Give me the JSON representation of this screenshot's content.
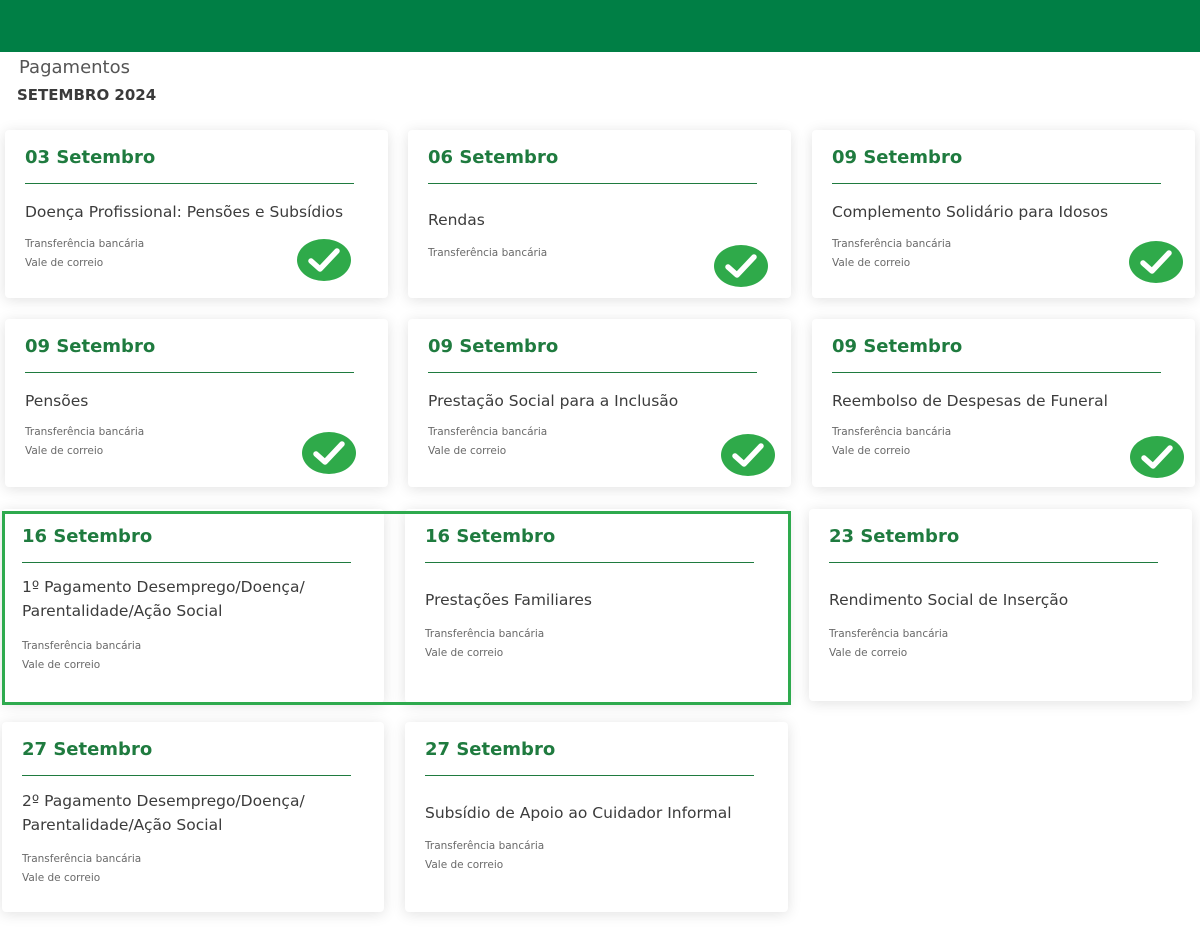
{
  "header": {
    "title": "Pagamentos",
    "subtitle": "SETEMBRO 2024"
  },
  "colors": {
    "brand_green": "#007f45",
    "date_green": "#1f7b3f",
    "check_green": "#2faa4a",
    "highlight_green": "#2eaa4e"
  },
  "cards": [
    {
      "date": "03 Setembro",
      "title": "Doença Profissional: Pensões e Subsídios",
      "methods": [
        "Transferência bancária",
        "Vale de correio"
      ],
      "paid": true,
      "icon": "check-circle-icon"
    },
    {
      "date": "06 Setembro",
      "title": "Rendas",
      "methods": [
        "Transferência bancária"
      ],
      "paid": true,
      "icon": "check-circle-icon"
    },
    {
      "date": "09 Setembro",
      "title": "Complemento Solidário para Idosos",
      "methods": [
        "Transferência bancária",
        "Vale de correio"
      ],
      "paid": true,
      "icon": "check-circle-icon"
    },
    {
      "date": "09 Setembro",
      "title": "Pensões",
      "methods": [
        "Transferência bancária",
        "Vale de correio"
      ],
      "paid": true,
      "icon": "check-circle-icon"
    },
    {
      "date": "09 Setembro",
      "title": "Prestação Social para a Inclusão",
      "methods": [
        "Transferência bancária",
        "Vale de correio"
      ],
      "paid": true,
      "icon": "check-circle-icon"
    },
    {
      "date": "09 Setembro",
      "title": "Reembolso de Despesas de Funeral",
      "methods": [
        "Transferência bancária",
        "Vale de correio"
      ],
      "paid": true,
      "icon": "check-circle-icon"
    },
    {
      "date": "16 Setembro",
      "title": "1º Pagamento Desemprego/Doença/ Parentalidade/Ação Social",
      "methods": [
        "Transferência bancária",
        "Vale de correio"
      ],
      "paid": false
    },
    {
      "date": "16 Setembro",
      "title": "Prestações Familiares",
      "methods": [
        "Transferência bancária",
        "Vale de correio"
      ],
      "paid": false
    },
    {
      "date": "23 Setembro",
      "title": "Rendimento Social de Inserção",
      "methods": [
        "Transferência bancária",
        "Vale de correio"
      ],
      "paid": false
    },
    {
      "date": "27 Setembro",
      "title": "2º Pagamento Desemprego/Doença/ Parentalidade/Ação Social",
      "methods": [
        "Transferência bancária",
        "Vale de correio"
      ],
      "paid": false
    },
    {
      "date": "27 Setembro",
      "title": "Subsídio de Apoio ao Cuidador Informal",
      "methods": [
        "Transferência bancária",
        "Vale de correio"
      ],
      "paid": false
    }
  ]
}
